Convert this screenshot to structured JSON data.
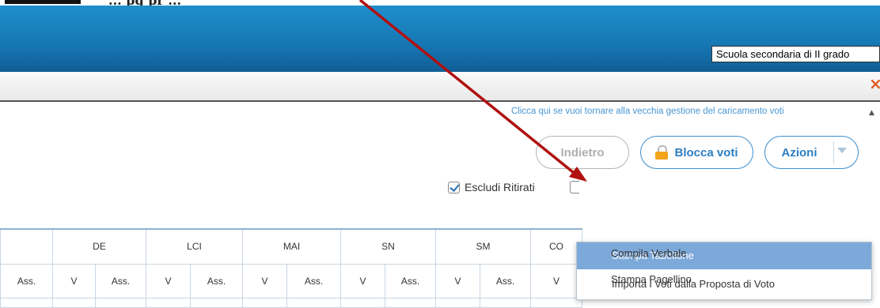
{
  "page": {
    "heading_fragment": "... pq pr ...",
    "school_level": "Scuola secondaria di II grado",
    "close_symbol": "×",
    "old_management_link": "Clicca qui se vuoi tornare alla vecchia gestione del caricamento voti"
  },
  "actions": {
    "back_label": "Indietro",
    "lock_label": "Blocca voti",
    "azioni_label": "Azioni"
  },
  "filters": {
    "escludi_ritirati": "Escludi Ritirati"
  },
  "grid": {
    "subjects": [
      "DE",
      "LCI",
      "MAI",
      "SN",
      "SM",
      "CO"
    ],
    "sub_headers": [
      "Ass.",
      "V",
      "Ass.",
      "V",
      "Ass.",
      "V",
      "Ass.",
      "V",
      "Ass.",
      "V",
      "Ass.",
      "V"
    ]
  },
  "azioni_menu": {
    "items": [
      "Stampa Tabellone",
      "Importa i Voti dalla Proposta di Voto",
      "Compila Verbale",
      "Stampa Pagellino"
    ],
    "selected_index": 0
  },
  "colors": {
    "banner": "#1779b5",
    "accent": "#2d7fc4",
    "menu_selected": "#7ca9d9",
    "annotation_arrow": "#b01010"
  },
  "icons": {
    "lock": "lock-icon",
    "checkbox": "checkbox-checked-icon",
    "close": "close-icon",
    "dropdown": "chevron-down-icon"
  }
}
